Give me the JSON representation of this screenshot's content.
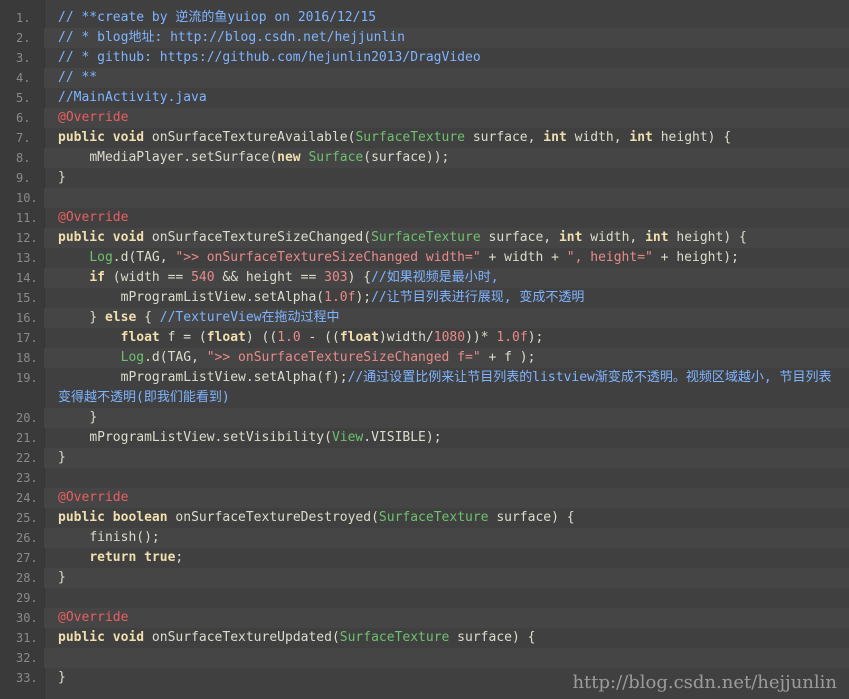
{
  "watermark": "http://blog.csdn.net/hejjunlin",
  "lines": [
    {
      "n": "1.",
      "t": [
        {
          "c": "comment",
          "s": "// **create by 逆流的鱼yuiop on 2016/12/15"
        }
      ]
    },
    {
      "n": "2.",
      "t": [
        {
          "c": "comment",
          "s": "// * blog地址: http://blog.csdn.net/hejjunlin"
        }
      ]
    },
    {
      "n": "3.",
      "t": [
        {
          "c": "comment",
          "s": "// * github: https://github.com/hejunlin2013/DragVideo"
        }
      ]
    },
    {
      "n": "4.",
      "t": [
        {
          "c": "comment",
          "s": "// **"
        }
      ]
    },
    {
      "n": "5.",
      "t": [
        {
          "c": "comment",
          "s": "//MainActivity.java"
        }
      ]
    },
    {
      "n": "6.",
      "t": [
        {
          "c": "ann",
          "s": "@Override"
        }
      ]
    },
    {
      "n": "7.",
      "t": [
        {
          "c": "kw",
          "s": "public"
        },
        {
          "c": "ident",
          "s": " "
        },
        {
          "c": "kw",
          "s": "void"
        },
        {
          "c": "ident",
          "s": " onSurfaceTextureAvailable("
        },
        {
          "c": "type",
          "s": "SurfaceTexture"
        },
        {
          "c": "ident",
          "s": " surface, "
        },
        {
          "c": "kw",
          "s": "int"
        },
        {
          "c": "ident",
          "s": " width, "
        },
        {
          "c": "kw",
          "s": "int"
        },
        {
          "c": "ident",
          "s": " height) {"
        }
      ]
    },
    {
      "n": "8.",
      "t": [
        {
          "c": "ident",
          "s": "    mMediaPlayer.setSurface("
        },
        {
          "c": "kw",
          "s": "new"
        },
        {
          "c": "ident",
          "s": " "
        },
        {
          "c": "type",
          "s": "Surface"
        },
        {
          "c": "ident",
          "s": "(surface));"
        }
      ]
    },
    {
      "n": "9.",
      "t": [
        {
          "c": "ident",
          "s": "}"
        }
      ]
    },
    {
      "n": "10.",
      "t": []
    },
    {
      "n": "11.",
      "t": [
        {
          "c": "ann",
          "s": "@Override"
        }
      ]
    },
    {
      "n": "12.",
      "t": [
        {
          "c": "kw",
          "s": "public"
        },
        {
          "c": "ident",
          "s": " "
        },
        {
          "c": "kw",
          "s": "void"
        },
        {
          "c": "ident",
          "s": " onSurfaceTextureSizeChanged("
        },
        {
          "c": "type",
          "s": "SurfaceTexture"
        },
        {
          "c": "ident",
          "s": " surface, "
        },
        {
          "c": "kw",
          "s": "int"
        },
        {
          "c": "ident",
          "s": " width, "
        },
        {
          "c": "kw",
          "s": "int"
        },
        {
          "c": "ident",
          "s": " height) {"
        }
      ]
    },
    {
      "n": "13.",
      "t": [
        {
          "c": "ident",
          "s": "    "
        },
        {
          "c": "type",
          "s": "Log"
        },
        {
          "c": "ident",
          "s": ".d(TAG, "
        },
        {
          "c": "str",
          "s": "\">> onSurfaceTextureSizeChanged width=\""
        },
        {
          "c": "ident",
          "s": " + width + "
        },
        {
          "c": "str",
          "s": "\", height=\""
        },
        {
          "c": "ident",
          "s": " + height);"
        }
      ]
    },
    {
      "n": "14.",
      "t": [
        {
          "c": "ident",
          "s": "    "
        },
        {
          "c": "kw",
          "s": "if"
        },
        {
          "c": "ident",
          "s": " (width == "
        },
        {
          "c": "num",
          "s": "540"
        },
        {
          "c": "ident",
          "s": " && height == "
        },
        {
          "c": "num",
          "s": "303"
        },
        {
          "c": "ident",
          "s": ") {"
        },
        {
          "c": "comment",
          "s": "//如果视频是最小时,"
        }
      ]
    },
    {
      "n": "15.",
      "t": [
        {
          "c": "ident",
          "s": "        mProgramListView.setAlpha("
        },
        {
          "c": "num",
          "s": "1.0f"
        },
        {
          "c": "ident",
          "s": ");"
        },
        {
          "c": "comment",
          "s": "//让节目列表进行展现, 变成不透明"
        }
      ]
    },
    {
      "n": "16.",
      "t": [
        {
          "c": "ident",
          "s": "    } "
        },
        {
          "c": "kw",
          "s": "else"
        },
        {
          "c": "ident",
          "s": " { "
        },
        {
          "c": "comment",
          "s": "//TextureView在拖动过程中"
        }
      ]
    },
    {
      "n": "17.",
      "t": [
        {
          "c": "ident",
          "s": "        "
        },
        {
          "c": "kw",
          "s": "float"
        },
        {
          "c": "ident",
          "s": " f = ("
        },
        {
          "c": "kw",
          "s": "float"
        },
        {
          "c": "ident",
          "s": ") (("
        },
        {
          "c": "num",
          "s": "1.0"
        },
        {
          "c": "ident",
          "s": " - (("
        },
        {
          "c": "kw",
          "s": "float"
        },
        {
          "c": "ident",
          "s": ")width/"
        },
        {
          "c": "num",
          "s": "1080"
        },
        {
          "c": "ident",
          "s": "))* "
        },
        {
          "c": "num",
          "s": "1.0f"
        },
        {
          "c": "ident",
          "s": ");"
        }
      ]
    },
    {
      "n": "18.",
      "t": [
        {
          "c": "ident",
          "s": "        "
        },
        {
          "c": "type",
          "s": "Log"
        },
        {
          "c": "ident",
          "s": ".d(TAG, "
        },
        {
          "c": "str",
          "s": "\">> onSurfaceTextureSizeChanged f=\""
        },
        {
          "c": "ident",
          "s": " + f );"
        }
      ]
    },
    {
      "n": "19.",
      "t": [
        {
          "c": "ident",
          "s": "        mProgramListView.setAlpha(f);"
        },
        {
          "c": "comment",
          "s": "//通过设置比例来让节目列表的listview渐变成不透明。视频区域越小, 节目列表变得越不透明(即我们能看到)"
        }
      ]
    },
    {
      "n": "20.",
      "t": [
        {
          "c": "ident",
          "s": "    }"
        }
      ]
    },
    {
      "n": "21.",
      "t": [
        {
          "c": "ident",
          "s": "    mProgramListView.setVisibility("
        },
        {
          "c": "type",
          "s": "View"
        },
        {
          "c": "ident",
          "s": ".VISIBLE);"
        }
      ]
    },
    {
      "n": "22.",
      "t": [
        {
          "c": "ident",
          "s": "}"
        }
      ]
    },
    {
      "n": "23.",
      "t": []
    },
    {
      "n": "24.",
      "t": [
        {
          "c": "ann",
          "s": "@Override"
        }
      ]
    },
    {
      "n": "25.",
      "t": [
        {
          "c": "kw",
          "s": "public"
        },
        {
          "c": "ident",
          "s": " "
        },
        {
          "c": "kw",
          "s": "boolean"
        },
        {
          "c": "ident",
          "s": " onSurfaceTextureDestroyed("
        },
        {
          "c": "type",
          "s": "SurfaceTexture"
        },
        {
          "c": "ident",
          "s": " surface) {"
        }
      ]
    },
    {
      "n": "26.",
      "t": [
        {
          "c": "ident",
          "s": "    finish();"
        }
      ]
    },
    {
      "n": "27.",
      "t": [
        {
          "c": "ident",
          "s": "    "
        },
        {
          "c": "kw",
          "s": "return"
        },
        {
          "c": "ident",
          "s": " "
        },
        {
          "c": "kw",
          "s": "true"
        },
        {
          "c": "ident",
          "s": ";"
        }
      ]
    },
    {
      "n": "28.",
      "t": [
        {
          "c": "ident",
          "s": "}"
        }
      ]
    },
    {
      "n": "29.",
      "t": []
    },
    {
      "n": "30.",
      "t": [
        {
          "c": "ann",
          "s": "@Override"
        }
      ]
    },
    {
      "n": "31.",
      "t": [
        {
          "c": "kw",
          "s": "public"
        },
        {
          "c": "ident",
          "s": " "
        },
        {
          "c": "kw",
          "s": "void"
        },
        {
          "c": "ident",
          "s": " onSurfaceTextureUpdated("
        },
        {
          "c": "type",
          "s": "SurfaceTexture"
        },
        {
          "c": "ident",
          "s": " surface) {"
        }
      ]
    },
    {
      "n": "32.",
      "t": []
    },
    {
      "n": "33.",
      "t": [
        {
          "c": "ident",
          "s": "}"
        }
      ]
    }
  ]
}
